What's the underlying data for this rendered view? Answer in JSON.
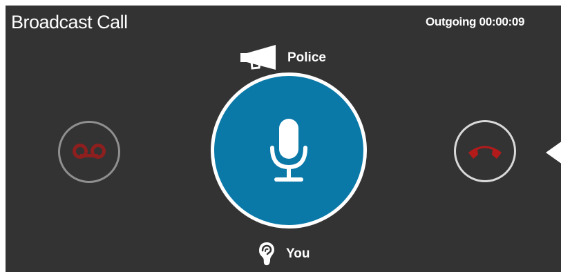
{
  "header": {
    "title": "Broadcast Call",
    "status": "Outgoing 00:00:09"
  },
  "speaker": {
    "icon": "megaphone-icon",
    "label": "Police"
  },
  "listener": {
    "icon": "ear-icon",
    "label": "You"
  },
  "controls": {
    "push_to_talk_icon": "microphone-icon",
    "voicemail_icon": "voicemail-icon",
    "hangup_icon": "phone-hangup-icon",
    "expand_icon": "arrow-left-icon"
  },
  "colors": {
    "panel_background": "#333333",
    "ptt_blue": "#0a79a8",
    "hangup_red": "#b31b1b",
    "voicemail_red": "#8e1f1f",
    "white": "#ffffff"
  }
}
